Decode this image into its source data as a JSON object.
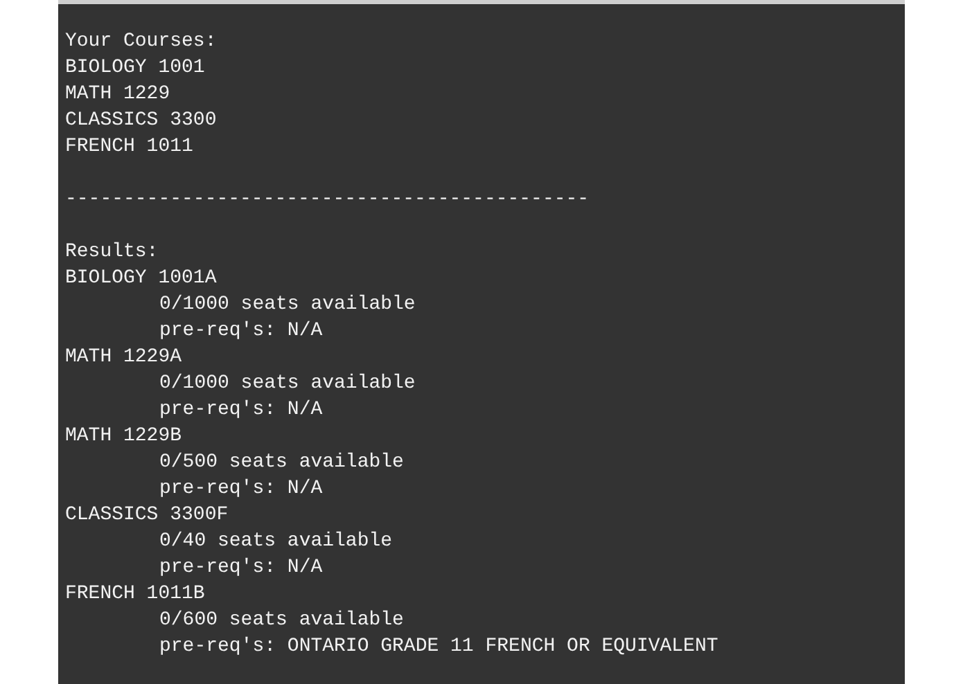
{
  "your_courses": {
    "heading": "Your Courses:",
    "courses": [
      "BIOLOGY 1001",
      "MATH 1229",
      "CLASSICS 3300",
      "FRENCH 1011"
    ]
  },
  "separator": "---------------------------------------------",
  "results": {
    "heading": "Results:",
    "sections": [
      {
        "section": "BIOLOGY 1001A",
        "seats": "0/1000 seats available",
        "prereqs": "pre-req's: N/A"
      },
      {
        "section": "MATH 1229A",
        "seats": "0/1000 seats available",
        "prereqs": "pre-req's: N/A"
      },
      {
        "section": "MATH 1229B",
        "seats": "0/500 seats available",
        "prereqs": "pre-req's: N/A"
      },
      {
        "section": "CLASSICS 3300F",
        "seats": "0/40 seats available",
        "prereqs": "pre-req's: N/A"
      },
      {
        "section": "FRENCH 1011B",
        "seats": "0/600 seats available",
        "prereqs": "pre-req's: ONTARIO GRADE 11 FRENCH OR EQUIVALENT"
      }
    ]
  }
}
